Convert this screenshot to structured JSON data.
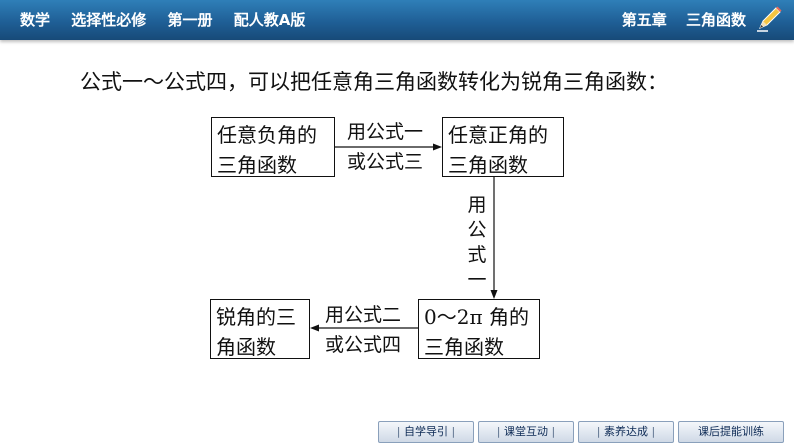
{
  "header": {
    "subject": "数学",
    "course": "选择性必修",
    "volume": "第一册",
    "edition": "配人教A版",
    "chapter": "第五章",
    "chapter_title": "三角函数",
    "icon": "pencil-icon"
  },
  "content": {
    "intro": "公式一～公式四，可以把任意角三角函数转化为锐角三角函数：",
    "boxes": {
      "negative_angle": [
        "任意负角的",
        "三角函数"
      ],
      "positive_angle": [
        "任意正角的",
        "三角函数"
      ],
      "range_angle": [
        "0～2π 角的",
        "三角函数"
      ],
      "acute_angle": [
        "锐角的三",
        "角函数"
      ]
    },
    "arrows": {
      "first": [
        "用公式一",
        "或公式三"
      ],
      "second": [
        "用",
        "公",
        "式",
        "一"
      ],
      "third": [
        "用公式二",
        "或公式四"
      ]
    }
  },
  "nav": {
    "items": [
      "自学导引",
      "课堂互动",
      "素养达成",
      "课后提能训练"
    ]
  },
  "colors": {
    "header_bar": "#1f5f96",
    "header_text": "#ffffff",
    "nav_text": "#0d2a55"
  }
}
